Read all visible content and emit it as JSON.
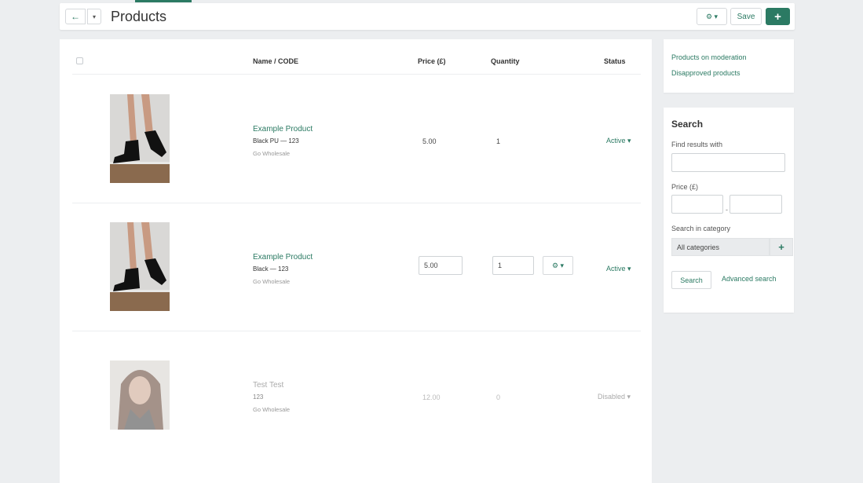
{
  "header": {
    "title": "Products",
    "back_icon": "←",
    "caret": "▾",
    "gear_label": "⚙ ▾",
    "save_label": "Save",
    "add_label": "+"
  },
  "table": {
    "columns": {
      "name": "Name   /   CODE",
      "price": "Price (£)",
      "quantity": "Quantity",
      "status": "Status"
    },
    "rows": [
      {
        "name": "Example Product",
        "code": "Black PU — 123",
        "vendor": "Go Wholesale",
        "price": "5.00",
        "quantity": "1",
        "status": "Active ▾"
      },
      {
        "name": "Example Product",
        "code": "Black — 123",
        "vendor": "Go Wholesale",
        "price": "5.00",
        "quantity": "1",
        "status": "Active ▾",
        "gear_label": "⚙ ▾"
      },
      {
        "name": "Test Test",
        "code": "123",
        "vendor": "Go Wholesale",
        "price": "12.00",
        "quantity": "0",
        "status": "Disabled ▾"
      }
    ]
  },
  "sidebar": {
    "links": [
      "Products on moderation",
      "Disapproved products"
    ],
    "search": {
      "title": "Search",
      "find_label": "Find results with",
      "price_label": "Price (£)",
      "range_sep": "-",
      "category_label": "Search in category",
      "category_value": "All categories",
      "add_label": "+",
      "search_button": "Search",
      "advanced_link": "Advanced search"
    }
  },
  "colors": {
    "accent": "#2b7a63",
    "background": "#eceef0"
  }
}
